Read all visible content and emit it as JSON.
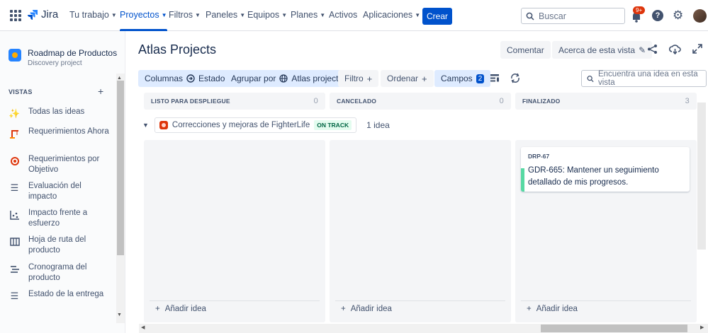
{
  "nav": {
    "logo": "Jira",
    "items": [
      {
        "label": "Tu trabajo",
        "chevron": true
      },
      {
        "label": "Proyectos",
        "chevron": true,
        "active": true
      },
      {
        "label": "Filtros",
        "chevron": true
      },
      {
        "label": "Paneles",
        "chevron": true
      },
      {
        "label": "Equipos",
        "chevron": true
      },
      {
        "label": "Planes",
        "chevron": true
      },
      {
        "label": "Activos",
        "chevron": false
      },
      {
        "label": "Aplicaciones",
        "chevron": true
      }
    ],
    "create_label": "Crear",
    "search_placeholder": "Buscar",
    "notification_badge": "9+",
    "accent": "#0052cc"
  },
  "sidebar": {
    "project_name": "Roadmap de Productos",
    "project_type": "Discovery project",
    "section_label": "VISTAS",
    "items": [
      {
        "icon": "sparkle-icon",
        "label": "Todas las ideas"
      },
      {
        "icon": "crane-icon",
        "label": "Requerimientos Ahora"
      },
      {
        "icon": "target-icon",
        "label": "Requerimientos por Objetivo"
      },
      {
        "icon": "list-icon",
        "label": "Evaluación del impacto"
      },
      {
        "icon": "scatter-icon",
        "label": "Impacto frente a esfuerzo"
      },
      {
        "icon": "board-icon",
        "label": "Hoja de ruta del producto"
      },
      {
        "icon": "timeline-icon",
        "label": "Cronograma del producto"
      },
      {
        "icon": "list-icon",
        "label": "Estado de la entrega"
      }
    ]
  },
  "main": {
    "title": "Atlas Projects",
    "comment_label": "Comentar",
    "about_label": "Acerca de esta vista",
    "toolbar": {
      "columns_label": "Columnas",
      "columns_value": "Estado",
      "group_label": "Agrupar por",
      "group_value": "Atlas project",
      "filter_label": "Filtro",
      "sort_label": "Ordenar",
      "fields_label": "Campos",
      "fields_count": "2",
      "find_placeholder": "Encuentra una idea en esta vista"
    },
    "columns": [
      {
        "name": "LISTO PARA DESPLIEGUE",
        "count": "0"
      },
      {
        "name": "CANCELADO",
        "count": "0"
      },
      {
        "name": "FINALIZADO",
        "count": "3"
      }
    ],
    "group": {
      "name": "Correcciones y mejoras de FighterLife",
      "status": "ON TRACK",
      "count": "1 idea"
    },
    "card": {
      "key": "DRP-67",
      "title": "GDR-665: Mantener un seguimiento detallado de mis progresos."
    },
    "add_label": "Añadir idea"
  }
}
